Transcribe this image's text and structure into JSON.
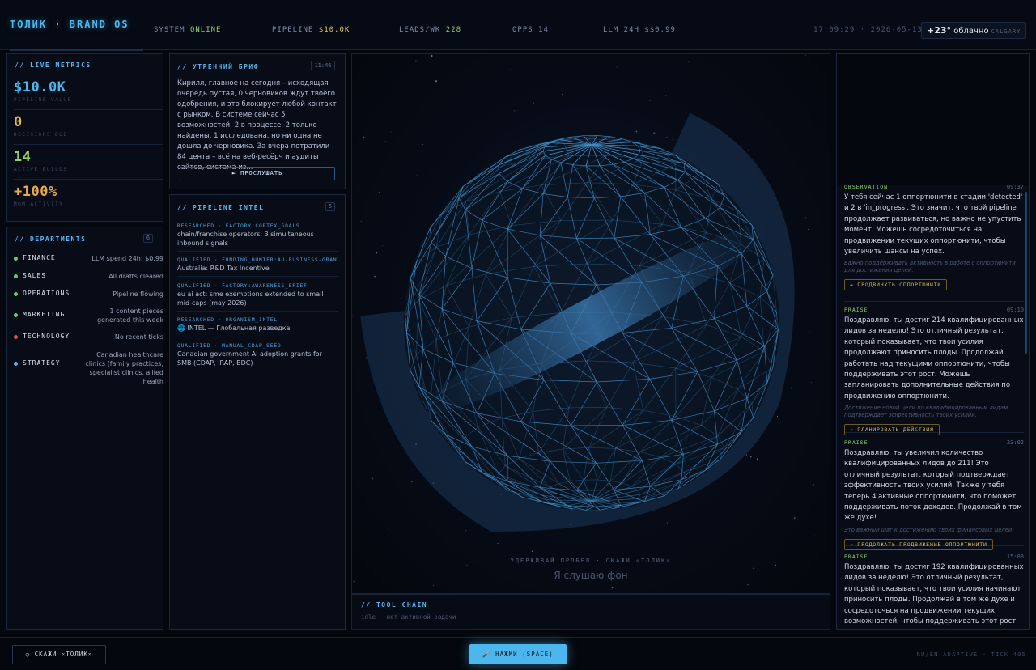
{
  "header": {
    "brand": "ТОЛИК · BRAND OS",
    "system_label": "SYSTEM",
    "system_value": "ONLINE",
    "pipeline_label": "PIPELINE",
    "pipeline_value": "$10.0K",
    "leads_label": "LEADS/WK",
    "leads_value": "228",
    "opps": "OPPS 14",
    "llm": "LLM 24H $$0.99",
    "clock": "17:09:29 · 2026-05-13",
    "weather_temp": "+23°",
    "weather_cond": "облачно",
    "weather_city": "CALGARY"
  },
  "live_metrics": {
    "title": "// LIVE METRICS",
    "items": [
      {
        "value": "$10.0K",
        "label": "PIPELINE VALUE",
        "color": "#4db8f0"
      },
      {
        "value": "0",
        "label": "DECISIONS DUE",
        "color": "#e0b84e"
      },
      {
        "value": "14",
        "label": "ACTIVE BUILDS",
        "color": "#8fd16a"
      },
      {
        "value": "+100%",
        "label": "MOM ACTIVITY",
        "color": "#e8a84a"
      }
    ]
  },
  "departments": {
    "title": "// DEPARTMENTS",
    "count": "6",
    "items": [
      {
        "name": "FINANCE",
        "status": "LLM spend 24h: $0.99",
        "color": "#5fcf6f"
      },
      {
        "name": "SALES",
        "status": "All drafts cleared",
        "color": "#5fcf6f"
      },
      {
        "name": "OPERATIONS",
        "status": "Pipeline flowing",
        "color": "#5fcf6f"
      },
      {
        "name": "MARKETING",
        "status": "1 content pieces generated this week",
        "color": "#5fcf6f"
      },
      {
        "name": "TECHNOLOGY",
        "status": "No recent ticks",
        "color": "#e0505a"
      },
      {
        "name": "STRATEGY",
        "status": "Canadian healthcare clinics (family practices, specialist clinics, allied health",
        "color": "#4db8f0"
      }
    ]
  },
  "brief": {
    "title": "// УТРЕННИЙ БРИФ",
    "time": "11:46",
    "text": "Кирилл, главное на сегодня – исходящая очередь пустая, 0 черновиков ждут твоего одобрения, и это блокирует любой контакт с рынком. В системе сейчас 5 возможностей: 2 в процессе, 2 только найдены, 1 исследована, но ни одна не дошла до черновика. За вчера потратили 84 цента – всё на веб-ресёрч и аудиты сайтов, система из...",
    "listen_label": "► ПРОСЛУШАТЬ"
  },
  "pipeline_intel": {
    "title": "// PIPELINE INTEL",
    "count": "5",
    "items": [
      {
        "tag": "RESEARCHED · FACTORY:CORTEX_GOALS",
        "text": "chain/franchise operators: 3 simultaneous inbound signals"
      },
      {
        "tag": "QUALIFIED · FUNDING_HUNTER:AU-BUSINESS-GRANTS",
        "text": "Australia: R&D Tax Incentive"
      },
      {
        "tag": "QUALIFIED · FACTORY:AWARENESS_BRIEF",
        "text": "eu ai act: sme exemptions extended to small mid-caps (may 2026)"
      },
      {
        "tag": "RESEARCHED · ORGANISM_INTEL",
        "text": "🌐 INTEL — Глобальная разведка"
      },
      {
        "tag": "QUALIFIED · MANUAL_CDAP_SEED",
        "text": "Canadian government AI adoption grants for SMB (CDAP, IRAP, BDC)"
      }
    ]
  },
  "voice": {
    "hint": "УДЕРЖИВАЙ ПРОБЕЛ · СКАЖИ «ТОЛИК»",
    "status": "Я слушаю фон"
  },
  "tool_chain": {
    "title": "// TOOL CHAIN",
    "status": "idle · нет активной задачи"
  },
  "feed": {
    "items": [
      {
        "kind": "OBSERVATION",
        "time": "09:37",
        "text": "У тебя сейчас 1 оппортюнити в стадии 'detected' и 2 в 'in_progress'. Это значит, что твой pipeline продолжает развиваться, но важно не упустить момент. Можешь сосредоточиться на продвижении текущих оппортюнити, чтобы увеличить шансы на успех.",
        "note": "Важно поддерживать активность в работе с оппортюнити для достижения целей.",
        "action": "→ ПРОДВИНУТЬ ОППОРТЮНИТИ"
      },
      {
        "kind": "PRAISE",
        "time": "09:10",
        "text": "Поздравляю, ты достиг 214 квалифицированных лидов за неделю! Это отличный результат, который показывает, что твои усилия продолжают приносить плоды. Продолжай работать над текущими оппортюнити, чтобы поддерживать этот рост. Можешь запланировать дополнительные действия по продвижению оппортюнити.",
        "note": "Достижение новой цели по квалифицированным лидам подтверждает эффективность твоих усилий.",
        "action": "→ ПЛАНИРОВАТЬ ДЕЙСТВИЯ"
      },
      {
        "kind": "PRAISE",
        "time": "23:02",
        "text": "Поздравляю, ты увеличил количество квалифицированных лидов до 211! Это отличный результат, который подтверждает эффективность твоих усилий. Также у тебя теперь 4 активные оппортюнити, что поможет поддерживать поток доходов. Продолжай в том же духе!",
        "note": "Это важный шаг к достижению твоих финансовых целей.",
        "action": "→ ПРОДОЛЖАТЬ ПРОДВИЖЕНИЕ ОППОРТЮНИТИ"
      },
      {
        "kind": "PRAISE",
        "time": "15:03",
        "text": "Поздравляю, ты достиг 192 квалифицированных лидов за неделю! Это отличный результат, который показывает, что твои усилия начинают приносить плоды. Продолжай в том же духе и сосредоточься на продвижении текущих возможностей, чтобы поддерживать этот рост.",
        "note": "",
        "action": ""
      }
    ]
  },
  "bottom": {
    "say_label": "○ СКАЖИ «ТОЛИК»",
    "press_label": "🎤 НАЖМИ (SPACE)",
    "mode": "RU/EN ADAPTIVE · TICK 405"
  }
}
